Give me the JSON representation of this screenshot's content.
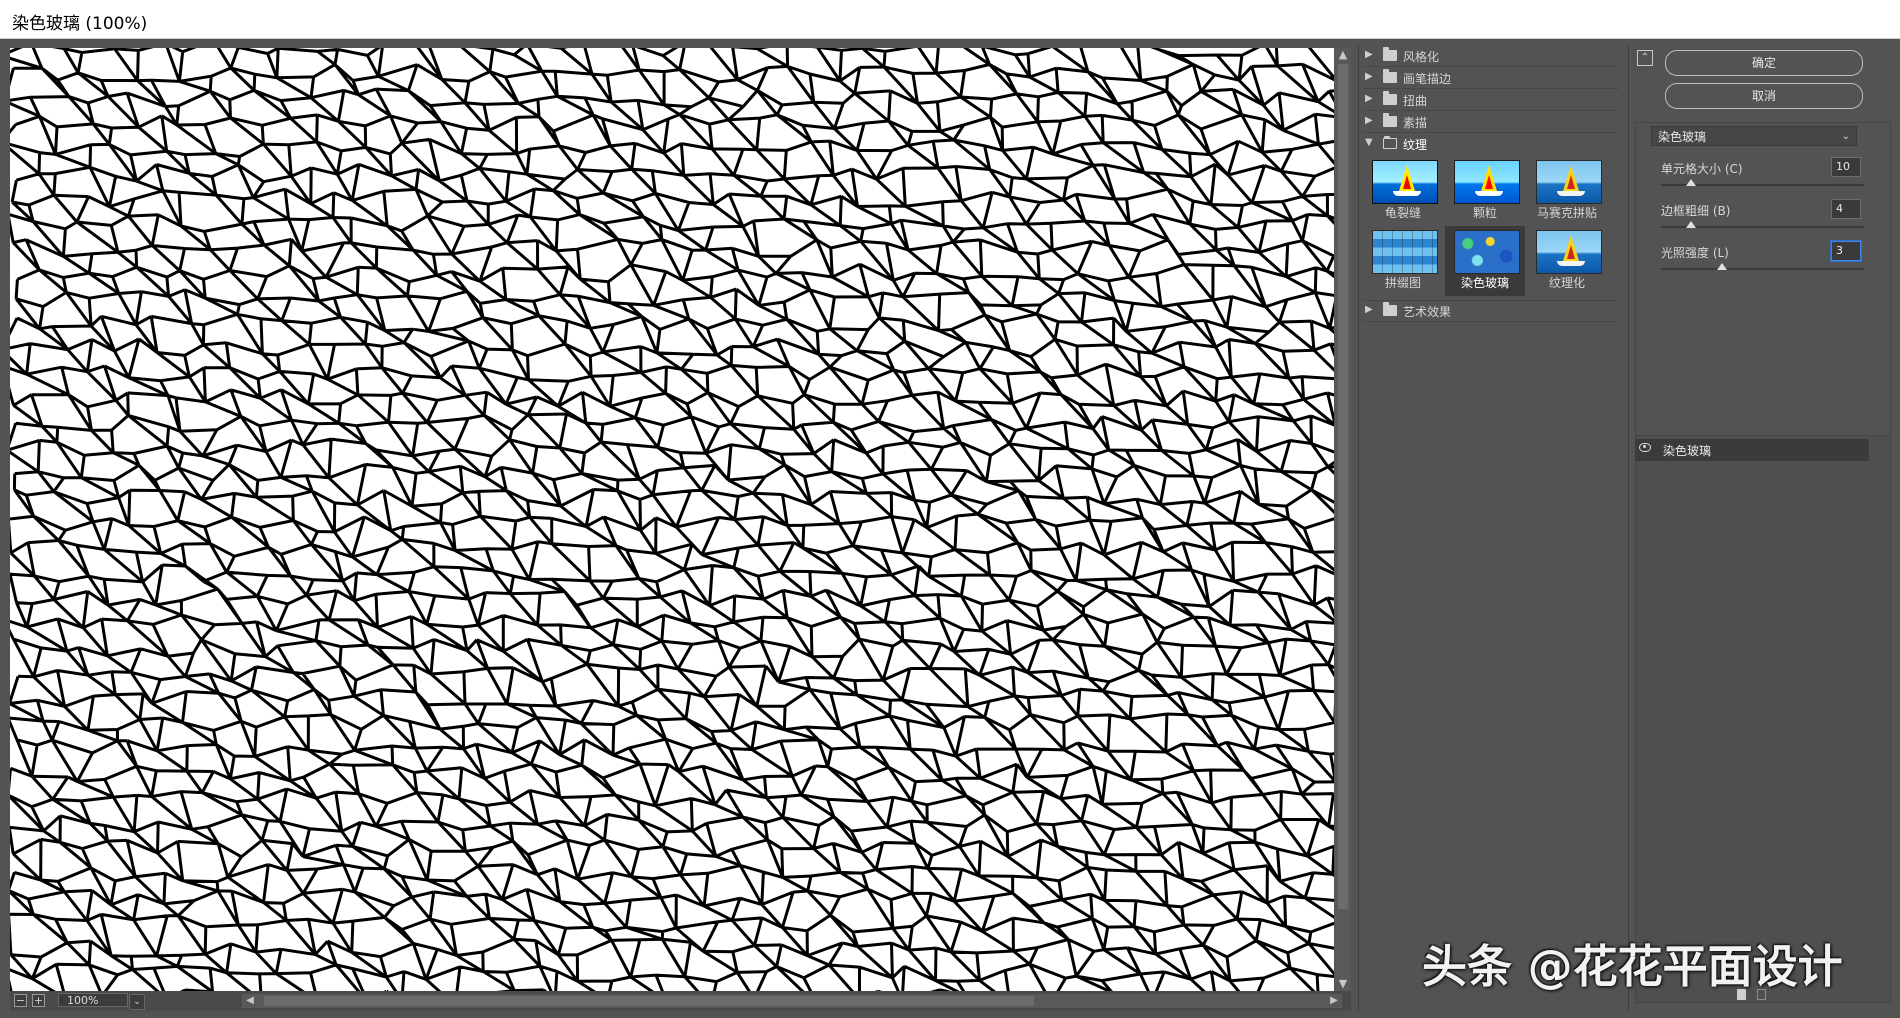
{
  "window": {
    "title": "染色玻璃 (100%)"
  },
  "preview": {
    "zoom": "100%",
    "zoom_in_label": "+",
    "zoom_out_label": "−"
  },
  "gallery": {
    "categories": [
      {
        "label": "风格化",
        "expanded": false
      },
      {
        "label": "画笔描边",
        "expanded": false
      },
      {
        "label": "扭曲",
        "expanded": false
      },
      {
        "label": "素描",
        "expanded": false
      },
      {
        "label": "纹理",
        "expanded": true
      },
      {
        "label": "艺术效果",
        "expanded": false
      }
    ],
    "texture_filters": [
      {
        "label": "龟裂缝",
        "selected": false
      },
      {
        "label": "颗粒",
        "selected": false
      },
      {
        "label": "马赛克拼贴",
        "selected": false
      },
      {
        "label": "拼缀图",
        "selected": false
      },
      {
        "label": "染色玻璃",
        "selected": true
      },
      {
        "label": "纹理化",
        "selected": false
      }
    ]
  },
  "panel": {
    "ok_label": "确定",
    "cancel_label": "取消",
    "filter_select": "染色玻璃",
    "params": [
      {
        "label": "单元格大小 (C)",
        "value": "10",
        "fraction": 0.15
      },
      {
        "label": "边框粗细 (B)",
        "value": "4",
        "fraction": 0.15
      },
      {
        "label": "光照强度 (L)",
        "value": "3",
        "fraction": 0.3
      }
    ],
    "layer_name": "染色玻璃"
  },
  "watermark": "头条 @花花平面设计",
  "colors": {
    "bg": "#535353",
    "active_field_border": "#3d86e6",
    "preview_bg": "#ffffff",
    "cell_line": "#000000"
  }
}
